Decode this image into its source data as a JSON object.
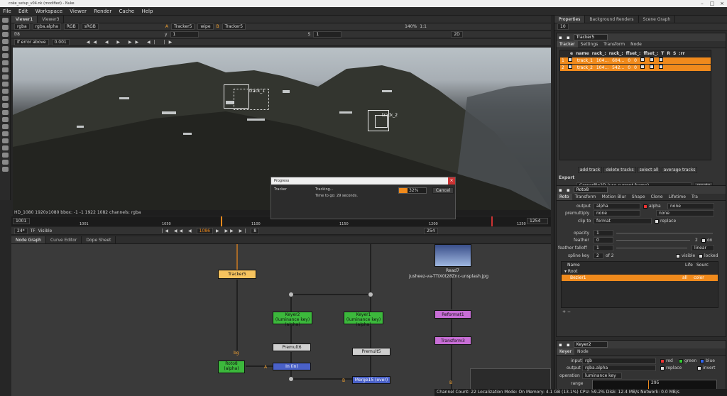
{
  "window": {
    "title": "coke_setup_v04.nk (modified) - Nuke"
  },
  "menu": [
    "File",
    "Edit",
    "Workspace",
    "Viewer",
    "Render",
    "Cache",
    "Help"
  ],
  "viewer_tabs": [
    "Viewer1",
    "Viewer3"
  ],
  "viewer_toolbar": {
    "channels": "rgba",
    "alpha": "rgba.alpha",
    "rgb": "RGB",
    "colorspace": "sRGB",
    "a_input": "A",
    "a_node": "Tracker5",
    "wipe": "wipe",
    "b_input": "B",
    "b_node": "Tracker5",
    "zoom": "140%",
    "ratio": "1:1",
    "mode": "2D",
    "fstop": "f/8",
    "frame_indicator": "1",
    "y": "1",
    "s": "1",
    "error": "if error above",
    "error_val": "0.001"
  },
  "viewer_info": "HD_1080 1920x1080  bbox: -1 -1 1922 1082 channels: rgba",
  "tracks_overlay": [
    "track_1",
    "track_2"
  ],
  "timeline": {
    "start": "1001",
    "end": "1254",
    "ticks": [
      "1001",
      "1050",
      "1100",
      "1150",
      "1200",
      "1250"
    ],
    "fps": "24*",
    "tf": "TF",
    "visible": "Visible",
    "current": "1086",
    "step": "8",
    "end_frame": "254",
    "I": "I"
  },
  "progress": {
    "title": "Progress",
    "label": "Tracker",
    "status": "Tracking...",
    "time": "Time to go: 29 seconds.",
    "percent": "32%",
    "cancel": "Cancel"
  },
  "bottom_tabs": [
    "Node Graph",
    "Curve Editor",
    "Dope Sheet"
  ],
  "nodes": {
    "tracker5": "Tracker5",
    "read7": "Read7",
    "read7_file": "jusheez-va-TTIX0t28Znc-unsplash.jpg",
    "keyer2": "Keyer2 (luminance key)",
    "keyer2_sub": "(alpha)",
    "keyer1": "Keyer1 (luminance key)",
    "keyer1_sub": "(alpha)",
    "reformat1": "Reformat1",
    "transform3": "Transform3",
    "premult6": "Premult6",
    "premult5": "Premult5",
    "roto8": "Roto8",
    "roto8_sub": "(alpha)",
    "in": "In (in)",
    "merge15": "Merge15 (over)",
    "bg": "bg",
    "A": "A",
    "B": "B"
  },
  "properties": {
    "tabs": [
      "Properties",
      "Background Renders",
      "Scene Graph"
    ],
    "count": "10",
    "tracker": {
      "name": "Tracker5",
      "tabs": [
        "Tracker",
        "Settings",
        "Transform",
        "Node"
      ],
      "columns": [
        "e",
        "name",
        "rack_:",
        "rack_:",
        "ffset_:",
        "ffset_:",
        "T",
        "R",
        "S",
        ":rr"
      ],
      "rows": [
        {
          "n": "1",
          "name": "track_1",
          "x": "104...",
          "y": "604...",
          "ox": "0",
          "oy": "0"
        },
        {
          "n": "2",
          "name": "track_2",
          "x": "104...",
          "y": "542...",
          "ox": "0",
          "oy": "0"
        }
      ],
      "buttons": [
        "add track",
        "delete tracks",
        "select all",
        "average tracks"
      ],
      "export_label": "Export",
      "export_value": "CornerPin2D (use current frame)",
      "create": "create"
    },
    "roto": {
      "name": "Roto8",
      "tabs": [
        "Roto",
        "Transform",
        "Motion Blur",
        "Shape",
        "Clone",
        "Lifetime",
        "Tra"
      ],
      "output_label": "output",
      "output": "alpha",
      "output_chk": "alpha",
      "output2": "none",
      "premult_label": "premultiply",
      "premult": "none",
      "premult2": "none",
      "clip_label": "clip to",
      "clip": "format",
      "replace": "replace",
      "opacity_label": "opacity",
      "opacity": "1",
      "feather_label": "feather",
      "feather": "0",
      "feather_n": "2",
      "feather_on": "on",
      "falloff_label": "feather falloff",
      "falloff": "1",
      "falloff_type": "linear",
      "spline_label": "spline key",
      "spline_key": "2",
      "spline_of": "of 2",
      "visible": "visible",
      "locked": "locked",
      "cols": [
        "Name",
        "Life",
        "Sourc"
      ],
      "root": "Root",
      "bezier": "Bezier1",
      "life": "all",
      "source": "color"
    },
    "keyer": {
      "name": "Keyer2",
      "tabs": [
        "Keyer",
        "Node"
      ],
      "input_label": "input",
      "input": "rgb",
      "red": "red",
      "green": "green",
      "blue": "blue",
      "output_label": "output",
      "output": "rgba.alpha",
      "replace": "replace",
      "invert": "invert",
      "operation_label": "operation",
      "operation": "luminance key",
      "range_label": "range",
      "range_val": "295"
    }
  },
  "status": "Channel Count: 22  Localization Mode: On  Memory: 4.1 GB (13.1%)  CPU: 59.2%  Disk: 12.4 MB/s  Network: 0.0 MB/s",
  "colors": {
    "accent": "#f08a1c",
    "track_row": "#f08a1c",
    "tracker_node": "#f6c35e",
    "keyer_node": "#3cb83c",
    "merge_node": "#4a61c8",
    "reformat_node": "#c86ed6",
    "read_node": "#bdbdbd"
  }
}
